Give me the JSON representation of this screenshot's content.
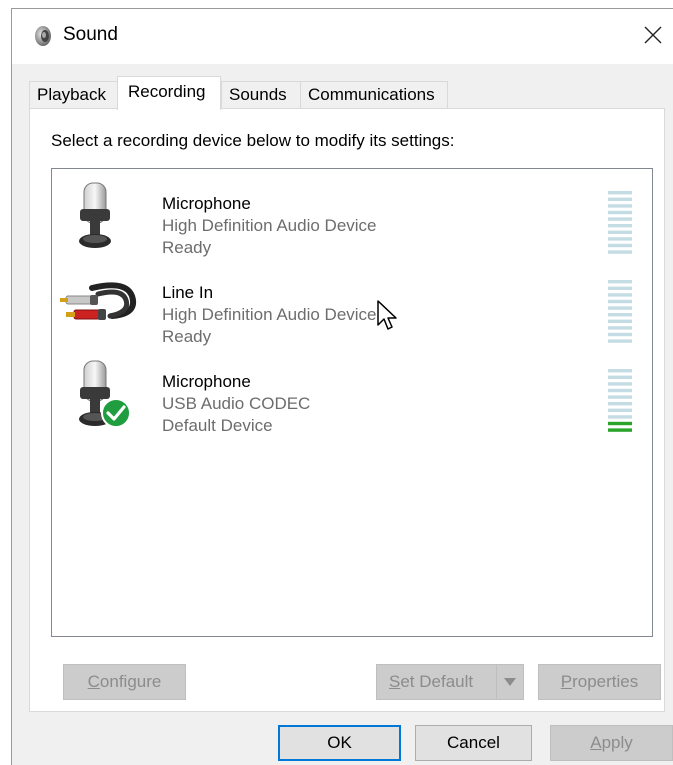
{
  "window": {
    "title": "Sound",
    "icon": "speaker-icon",
    "close_icon": "close-icon"
  },
  "tabs": [
    {
      "label": "Playback",
      "active": false
    },
    {
      "label": "Recording",
      "active": true
    },
    {
      "label": "Sounds",
      "active": false
    },
    {
      "label": "Communications",
      "active": false
    }
  ],
  "recording": {
    "prompt": "Select a recording device below to modify its settings:",
    "devices": [
      {
        "name": "Microphone",
        "driver": "High Definition Audio Device",
        "status": "Ready",
        "icon": "microphone-icon",
        "level": 0.0
      },
      {
        "name": "Line In",
        "driver": "High Definition Audio Device",
        "status": "Ready",
        "icon": "line-in-rca-icon",
        "level": 0.0
      },
      {
        "name": "Microphone",
        "driver": "USB Audio CODEC",
        "status": "Default Device",
        "icon": "microphone-default-icon",
        "badge_icon": "default-check-icon",
        "level": 0.2
      }
    ]
  },
  "buttons": {
    "configure": {
      "label": "Configure",
      "mnemonic": "C",
      "enabled": false
    },
    "set_default": {
      "label": "Set Default",
      "mnemonic": "S",
      "enabled": false,
      "arrow_icon": "dropdown-arrow-icon"
    },
    "properties": {
      "label": "Properties",
      "mnemonic": "P",
      "enabled": false
    },
    "ok": {
      "label": "OK",
      "enabled": true
    },
    "cancel": {
      "label": "Cancel",
      "enabled": true
    },
    "apply": {
      "label": "Apply",
      "mnemonic": "A",
      "enabled": false
    }
  },
  "colors": {
    "accent": "#0078d7",
    "meter_idle": "#c4dde5",
    "meter_active": "#2aa52a",
    "check_badge": "#1f9d3f"
  }
}
